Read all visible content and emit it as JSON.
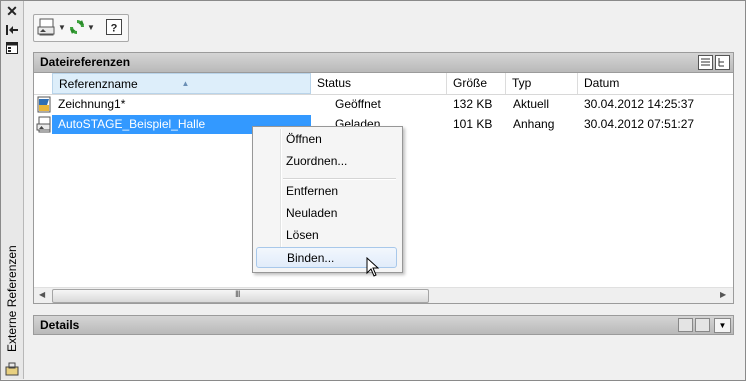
{
  "palette": {
    "side_title": "Externe Referenzen"
  },
  "panel": {
    "title": "Dateireferenzen",
    "columns": [
      "Referenzname",
      "Status",
      "Größe",
      "Typ",
      "Datum"
    ],
    "rows": [
      {
        "name": "Zeichnung1*",
        "status": "Geöffnet",
        "size": "132 KB",
        "type": "Aktuell",
        "date": "30.04.2012 14:25:37",
        "icon": "dwg-open-icon"
      },
      {
        "name": "AutoSTAGE_Beispiel_Halle",
        "status": "Geladen",
        "size": "101 KB",
        "type": "Anhang",
        "date": "30.04.2012 07:51:27",
        "icon": "dwg-icon"
      }
    ],
    "scroll_grip": "III"
  },
  "details": {
    "title": "Details"
  },
  "context_menu": {
    "items": [
      "Öffnen",
      "Zuordnen...",
      "Entfernen",
      "Neuladen",
      "Lösen",
      "Binden..."
    ],
    "highlighted": "Binden..."
  },
  "colors": {
    "selection": "#3399ff",
    "header": "#c8c8c8"
  }
}
